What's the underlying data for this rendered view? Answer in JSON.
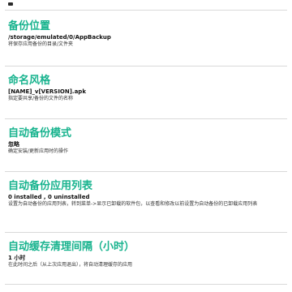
{
  "preferences": [
    {
      "title": "备份位置",
      "value": "/storage/emulated/0/AppBackup",
      "description": "将保存应用备份的目录/文件夹"
    },
    {
      "title": "命名风格",
      "value": "[NAME]_v[VERSION].apk",
      "description": "指定要共享/备份的文件的名称"
    },
    {
      "title": "自动备份模式",
      "value": "忽略",
      "description": "确定安装/更新应用时的操作"
    },
    {
      "title": "自动备份应用列表",
      "value": "0 installed , 0 uninstalled",
      "description": "设置为自动备份的应用列表，转到菜单->显示已卸载的软件包，以查看和修改以前设置为自动备份的已卸载应用列表"
    },
    {
      "title": "自动缓存清理间隔（小时）",
      "value": "1 小时",
      "description": "在此时间之后（从上次应用退出），将自动清理缓存的应用"
    }
  ]
}
